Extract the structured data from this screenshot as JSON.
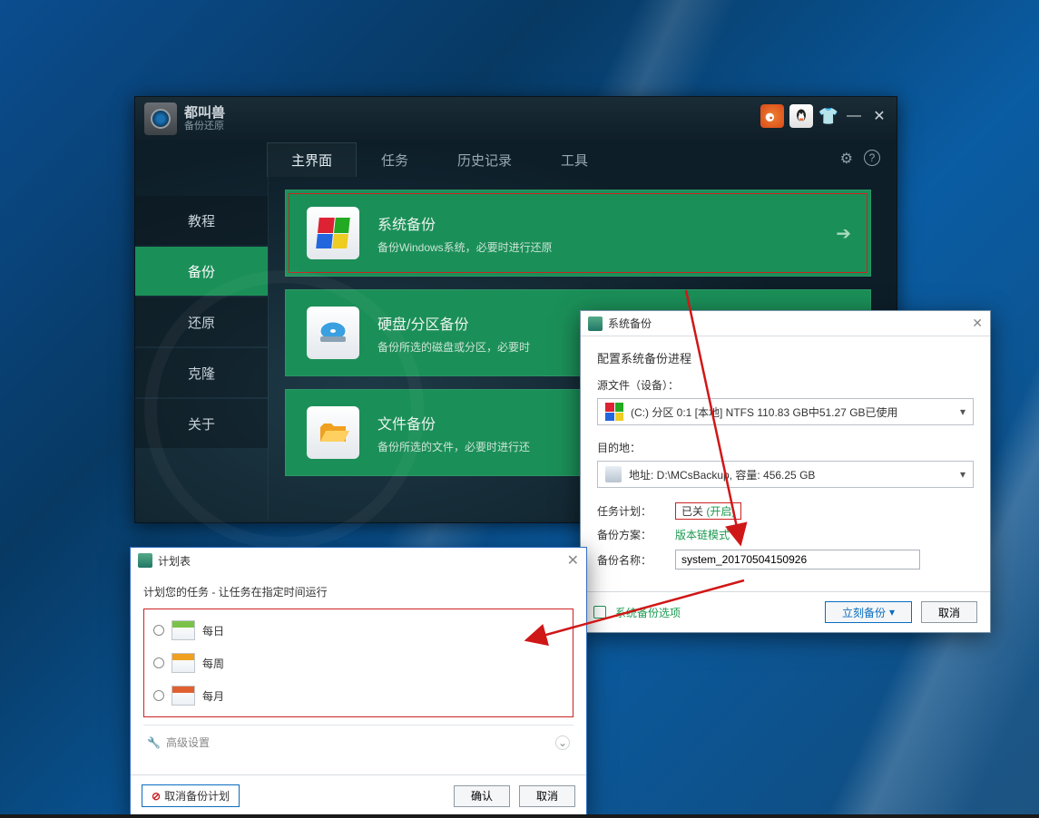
{
  "app": {
    "title": "都叫兽",
    "subtitle": "备份还原"
  },
  "top_tabs": {
    "main": "主界面",
    "task": "任务",
    "history": "历史记录",
    "tools": "工具"
  },
  "sidebar": {
    "tutorial": "教程",
    "backup": "备份",
    "restore": "还原",
    "clone": "克隆",
    "about": "关于"
  },
  "cards": {
    "system": {
      "title": "系统备份",
      "desc": "备份Windows系统，必要时进行还原"
    },
    "disk": {
      "title": "硬盘/分区备份",
      "desc": "备份所选的磁盘或分区，必要时"
    },
    "file": {
      "title": "文件备份",
      "desc": "备份所选的文件，必要时进行还"
    }
  },
  "dialog": {
    "title": "系统备份",
    "heading": "配置系统备份进程",
    "source_label": "源文件（设备）：",
    "source_value": "(C:) 分区 0:1 [本地]   NTFS   110.83 GB中51.27 GB已使用",
    "dest_label": "目的地：",
    "dest_value": "地址: D:\\MCsBackup, 容量: 456.25 GB",
    "plan_label": "任务计划：",
    "plan_value_off": "已关",
    "plan_value_open": "(开启)",
    "scheme_label": "备份方案：",
    "scheme_value": "版本链模式",
    "name_label": "备份名称：",
    "name_value": "system_20170504150926",
    "options_link": "系统备份选项",
    "backup_now": "立刻备份",
    "cancel": "取消"
  },
  "schedule": {
    "title": "计划表",
    "desc": "计划您的任务 - 让任务在指定时间运行",
    "daily": "每日",
    "weekly": "每周",
    "monthly": "每月",
    "advanced": "高级设置",
    "cancel_plan": "取消备份计划",
    "ok": "确认",
    "cancel": "取消"
  }
}
